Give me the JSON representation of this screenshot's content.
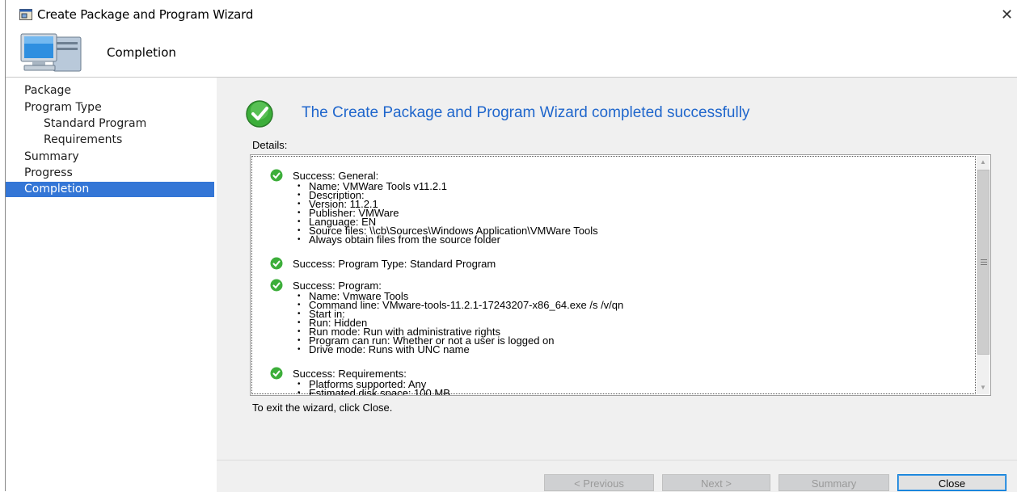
{
  "window": {
    "title": "Create Package and Program Wizard",
    "close_glyph": "✕"
  },
  "header": {
    "title": "Completion",
    "icon": "computer-icon"
  },
  "sidebar": {
    "items": [
      {
        "label": "Package",
        "level": 0,
        "selected": false
      },
      {
        "label": "Program Type",
        "level": 0,
        "selected": false
      },
      {
        "label": "Standard Program",
        "level": 1,
        "selected": false
      },
      {
        "label": "Requirements",
        "level": 1,
        "selected": false
      },
      {
        "label": "Summary",
        "level": 0,
        "selected": false
      },
      {
        "label": "Progress",
        "level": 0,
        "selected": false
      },
      {
        "label": "Completion",
        "level": 0,
        "selected": true
      }
    ]
  },
  "main": {
    "result_title": "The Create Package and Program Wizard completed successfully",
    "details_label": "Details:",
    "sections": [
      {
        "heading": "Success: General:",
        "items": [
          "Name: VMWare Tools v11.2.1",
          "Description:",
          "Version: 11.2.1",
          "Publisher: VMWare",
          "Language: EN",
          "Source files: \\\\cb\\Sources\\Windows Application\\VMWare Tools",
          "Always obtain files from the source folder"
        ]
      },
      {
        "heading": "Success: Program Type: Standard Program",
        "items": []
      },
      {
        "heading": "Success: Program:",
        "items": [
          "Name: Vmware Tools",
          "Command line: VMware-tools-11.2.1-17243207-x86_64.exe /s /v/qn",
          "Start in:",
          "Run: Hidden",
          "Run mode: Run with administrative rights",
          "Program can run: Whether or not a user is logged on",
          "Drive mode: Runs with UNC name"
        ]
      },
      {
        "heading": "Success: Requirements:",
        "items": [
          "Platforms supported: Any",
          "Estimated disk space: 100 MB"
        ]
      }
    ],
    "exit_text": "To exit the wizard, click Close."
  },
  "footer": {
    "previous_label": "< Previous",
    "next_label": "Next >",
    "summary_label": "Summary",
    "close_label": "Close"
  },
  "colors": {
    "accent": "#3476d6",
    "title_blue": "#1f66cc",
    "success_green": "#3cae3a"
  }
}
